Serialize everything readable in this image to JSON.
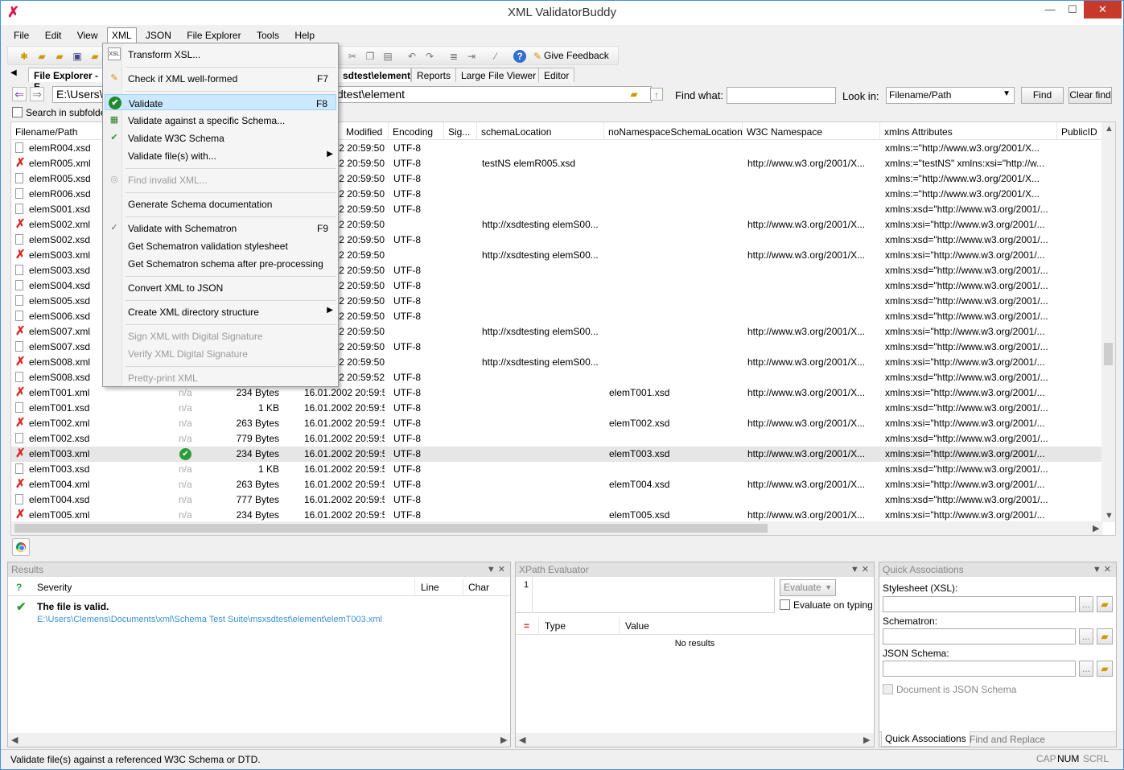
{
  "window": {
    "title": "XML ValidatorBuddy"
  },
  "menubar": [
    "File",
    "Edit",
    "View",
    "XML",
    "JSON",
    "File Explorer",
    "Tools",
    "Help"
  ],
  "toolbar": {
    "feedback_label": "Give Feedback"
  },
  "tabs": [
    "File Explorer - E",
    "sdtest\\element",
    "Reports",
    "Large File Viewer",
    "Editor"
  ],
  "path": {
    "value_left": "E:\\Users\\C",
    "value_right": "sdtest\\element"
  },
  "find": {
    "label": "Find what:",
    "lookin_label": "Look in:",
    "lookin_value": "Filename/Path",
    "find_btn": "Find",
    "clear_btn": "Clear find"
  },
  "search_subfolders": "Search in subfolders",
  "columns": [
    "Filename/Path",
    "Modified",
    "Encoding",
    "Sig...",
    "schemaLocation",
    "noNamespaceSchemaLocation",
    "W3C Namespace",
    "xmlns Attributes",
    "PublicID"
  ],
  "rows": [
    {
      "name": "elemR004.xsd",
      "icon": "doc",
      "status": "",
      "size": "",
      "mod": "02 20:59:50",
      "enc": "UTF-8",
      "schema": "",
      "nons": "",
      "w3c": "",
      "xmlns": "xmlns:=\"http://www.w3.org/2001/X..."
    },
    {
      "name": "elemR005.xml",
      "icon": "err",
      "status": "",
      "size": "",
      "mod": "02 20:59:50",
      "enc": "UTF-8",
      "schema": "testNS elemR005.xsd",
      "nons": "",
      "w3c": "http://www.w3.org/2001/X...",
      "xmlns": "xmlns:=\"testNS\" xmlns:xsi=\"http://w..."
    },
    {
      "name": "elemR005.xsd",
      "icon": "doc",
      "status": "",
      "size": "",
      "mod": "02 20:59:50",
      "enc": "UTF-8",
      "schema": "",
      "nons": "",
      "w3c": "",
      "xmlns": "xmlns:=\"http://www.w3.org/2001/X..."
    },
    {
      "name": "elemR006.xsd",
      "icon": "doc",
      "status": "",
      "size": "",
      "mod": "02 20:59:50",
      "enc": "UTF-8",
      "schema": "",
      "nons": "",
      "w3c": "",
      "xmlns": "xmlns:=\"http://www.w3.org/2001/X..."
    },
    {
      "name": "elemS001.xsd",
      "icon": "doc",
      "status": "",
      "size": "",
      "mod": "02 20:59:50",
      "enc": "UTF-8",
      "schema": "",
      "nons": "",
      "w3c": "",
      "xmlns": "xmlns:xsd=\"http://www.w3.org/2001/..."
    },
    {
      "name": "elemS002.xml",
      "icon": "err",
      "status": "",
      "size": "",
      "mod": "02 20:59:50",
      "enc": "",
      "schema": "http://xsdtesting elemS00...",
      "nons": "",
      "w3c": "http://www.w3.org/2001/X...",
      "xmlns": "xmlns:xsi=\"http://www.w3.org/2001/..."
    },
    {
      "name": "elemS002.xsd",
      "icon": "doc",
      "status": "",
      "size": "",
      "mod": "02 20:59:50",
      "enc": "UTF-8",
      "schema": "",
      "nons": "",
      "w3c": "",
      "xmlns": "xmlns:xsd=\"http://www.w3.org/2001/..."
    },
    {
      "name": "elemS003.xml",
      "icon": "err",
      "status": "",
      "size": "",
      "mod": "02 20:59:50",
      "enc": "",
      "schema": "http://xsdtesting elemS00...",
      "nons": "",
      "w3c": "http://www.w3.org/2001/X...",
      "xmlns": "xmlns:xsi=\"http://www.w3.org/2001/..."
    },
    {
      "name": "elemS003.xsd",
      "icon": "doc",
      "status": "",
      "size": "",
      "mod": "02 20:59:50",
      "enc": "UTF-8",
      "schema": "",
      "nons": "",
      "w3c": "",
      "xmlns": "xmlns:xsd=\"http://www.w3.org/2001/..."
    },
    {
      "name": "elemS004.xsd",
      "icon": "doc",
      "status": "",
      "size": "",
      "mod": "02 20:59:50",
      "enc": "UTF-8",
      "schema": "",
      "nons": "",
      "w3c": "",
      "xmlns": "xmlns:xsd=\"http://www.w3.org/2001/..."
    },
    {
      "name": "elemS005.xsd",
      "icon": "doc",
      "status": "",
      "size": "",
      "mod": "02 20:59:50",
      "enc": "UTF-8",
      "schema": "",
      "nons": "",
      "w3c": "",
      "xmlns": "xmlns:xsd=\"http://www.w3.org/2001/..."
    },
    {
      "name": "elemS006.xsd",
      "icon": "doc",
      "status": "",
      "size": "",
      "mod": "02 20:59:50",
      "enc": "UTF-8",
      "schema": "",
      "nons": "",
      "w3c": "",
      "xmlns": "xmlns:xsd=\"http://www.w3.org/2001/..."
    },
    {
      "name": "elemS007.xml",
      "icon": "err",
      "status": "",
      "size": "",
      "mod": "02 20:59:50",
      "enc": "",
      "schema": "http://xsdtesting elemS00...",
      "nons": "",
      "w3c": "http://www.w3.org/2001/X...",
      "xmlns": "xmlns:xsi=\"http://www.w3.org/2001/..."
    },
    {
      "name": "elemS007.xsd",
      "icon": "doc",
      "status": "",
      "size": "",
      "mod": "02 20:59:50",
      "enc": "UTF-8",
      "schema": "",
      "nons": "",
      "w3c": "",
      "xmlns": "xmlns:xsd=\"http://www.w3.org/2001/..."
    },
    {
      "name": "elemS008.xml",
      "icon": "err",
      "status": "",
      "size": "",
      "mod": "02 20:59:50",
      "enc": "",
      "schema": "http://xsdtesting elemS00...",
      "nons": "",
      "w3c": "http://www.w3.org/2001/X...",
      "xmlns": "xmlns:xsi=\"http://www.w3.org/2001/..."
    },
    {
      "name": "elemS008.xsd",
      "icon": "doc",
      "status": "",
      "size": "",
      "mod": "02 20:59:52",
      "enc": "UTF-8",
      "schema": "",
      "nons": "",
      "w3c": "",
      "xmlns": "xmlns:xsd=\"http://www.w3.org/2001/..."
    },
    {
      "name": "elemT001.xml",
      "icon": "err",
      "status": "n/a",
      "size": "234 Bytes",
      "mod": "16.01.2002 20:59:52",
      "enc": "UTF-8",
      "schema": "",
      "nons": "elemT001.xsd",
      "w3c": "http://www.w3.org/2001/X...",
      "xmlns": "xmlns:xsi=\"http://www.w3.org/2001/..."
    },
    {
      "name": "elemT001.xsd",
      "icon": "doc",
      "status": "n/a",
      "size": "1 KB",
      "mod": "16.01.2002 20:59:52",
      "enc": "UTF-8",
      "schema": "",
      "nons": "",
      "w3c": "",
      "xmlns": "xmlns:xsd=\"http://www.w3.org/2001/..."
    },
    {
      "name": "elemT002.xml",
      "icon": "err",
      "status": "n/a",
      "size": "263 Bytes",
      "mod": "16.01.2002 20:59:52",
      "enc": "UTF-8",
      "schema": "",
      "nons": "elemT002.xsd",
      "w3c": "http://www.w3.org/2001/X...",
      "xmlns": "xmlns:xsi=\"http://www.w3.org/2001/..."
    },
    {
      "name": "elemT002.xsd",
      "icon": "doc",
      "status": "n/a",
      "size": "779 Bytes",
      "mod": "16.01.2002 20:59:52",
      "enc": "UTF-8",
      "schema": "",
      "nons": "",
      "w3c": "",
      "xmlns": "xmlns:xsd=\"http://www.w3.org/2001/..."
    },
    {
      "name": "elemT003.xml",
      "icon": "err",
      "status": "valid",
      "size": "234 Bytes",
      "mod": "16.01.2002 20:59:52",
      "enc": "UTF-8",
      "schema": "",
      "nons": "elemT003.xsd",
      "w3c": "http://www.w3.org/2001/X...",
      "xmlns": "xmlns:xsi=\"http://www.w3.org/2001/...",
      "selected": true
    },
    {
      "name": "elemT003.xsd",
      "icon": "doc",
      "status": "n/a",
      "size": "1 KB",
      "mod": "16.01.2002 20:59:52",
      "enc": "UTF-8",
      "schema": "",
      "nons": "",
      "w3c": "",
      "xmlns": "xmlns:xsd=\"http://www.w3.org/2001/..."
    },
    {
      "name": "elemT004.xml",
      "icon": "err",
      "status": "n/a",
      "size": "263 Bytes",
      "mod": "16.01.2002 20:59:52",
      "enc": "UTF-8",
      "schema": "",
      "nons": "elemT004.xsd",
      "w3c": "http://www.w3.org/2001/X...",
      "xmlns": "xmlns:xsi=\"http://www.w3.org/2001/..."
    },
    {
      "name": "elemT004.xsd",
      "icon": "doc",
      "status": "n/a",
      "size": "777 Bytes",
      "mod": "16.01.2002 20:59:52",
      "enc": "UTF-8",
      "schema": "",
      "nons": "",
      "w3c": "",
      "xmlns": "xmlns:xsd=\"http://www.w3.org/2001/..."
    },
    {
      "name": "elemT005.xml",
      "icon": "err",
      "status": "n/a",
      "size": "234 Bytes",
      "mod": "16.01.2002 20:59:52",
      "enc": "UTF-8",
      "schema": "",
      "nons": "elemT005.xsd",
      "w3c": "http://www.w3.org/2001/X...",
      "xmlns": "xmlns:xsi=\"http://www.w3.org/2001/..."
    }
  ],
  "xml_menu": [
    {
      "label": "Transform XSL...",
      "shortcut": "",
      "icon": "xsl",
      "disabled": false
    },
    {
      "sep": true
    },
    {
      "label": "Check if XML well-formed",
      "shortcut": "F7",
      "icon": "pencil",
      "disabled": false
    },
    {
      "sep": true
    },
    {
      "label": "Validate",
      "shortcut": "F8",
      "icon": "check",
      "disabled": false,
      "highlight": true
    },
    {
      "label": "Validate against a specific Schema...",
      "shortcut": "",
      "icon": "schema",
      "disabled": false
    },
    {
      "label": "Validate W3C Schema",
      "shortcut": "",
      "icon": "w3c",
      "disabled": false
    },
    {
      "label": "Validate file(s) with...",
      "shortcut": "",
      "icon": "",
      "disabled": false,
      "submenu": true
    },
    {
      "sep": true
    },
    {
      "label": "Find invalid XML...",
      "shortcut": "",
      "icon": "search",
      "disabled": true
    },
    {
      "sep": true
    },
    {
      "label": "Generate Schema documentation",
      "shortcut": "",
      "icon": "",
      "disabled": false
    },
    {
      "sep": true
    },
    {
      "label": "Validate with Schematron",
      "shortcut": "F9",
      "icon": "schematron",
      "disabled": false
    },
    {
      "label": "Get Schematron validation stylesheet",
      "shortcut": "",
      "icon": "",
      "disabled": false
    },
    {
      "label": "Get Schematron schema after pre-processing",
      "shortcut": "",
      "icon": "",
      "disabled": false
    },
    {
      "sep": true
    },
    {
      "label": "Convert XML to JSON",
      "shortcut": "",
      "icon": "",
      "disabled": false
    },
    {
      "sep": true
    },
    {
      "label": "Create XML directory structure",
      "shortcut": "",
      "icon": "",
      "disabled": false,
      "submenu": true
    },
    {
      "sep": true
    },
    {
      "label": "Sign XML with Digital Signature",
      "shortcut": "",
      "icon": "",
      "disabled": true
    },
    {
      "label": "Verify XML Digital Signature",
      "shortcut": "",
      "icon": "",
      "disabled": true
    },
    {
      "sep": true
    },
    {
      "label": "Pretty-print XML",
      "shortcut": "",
      "icon": "",
      "disabled": true
    }
  ],
  "results": {
    "title": "Results",
    "col_mark": "?",
    "col_severity": "Severity",
    "col_line": "Line",
    "col_char": "Char",
    "message": "The file is valid.",
    "path": "E:\\Users\\Clemens\\Documents\\xml\\Schema Test Suite\\msxsdtest\\element\\elemT003.xml"
  },
  "xpath": {
    "title": "XPath Evaluator",
    "line_no": "1",
    "evaluate_btn": "Evaluate",
    "evaluate_on_typing": "Evaluate on typing",
    "col_mark": "=",
    "col_type": "Type",
    "col_value": "Value",
    "no_results": "No results"
  },
  "quick": {
    "title": "Quick Associations",
    "stylesheet_label": "Stylesheet (XSL):",
    "schematron_label": "Schematron:",
    "json_schema_label": "JSON Schema:",
    "doc_is_json_schema": "Document is JSON Schema",
    "browse": "...",
    "tab_quick": "Quick Associations",
    "tab_find": "Find and Replace"
  },
  "status": {
    "text": "Validate file(s) against a referenced W3C Schema or DTD.",
    "cap": "CAP",
    "num": "NUM",
    "scrl": "SCRL"
  },
  "colors": {
    "accent": "#1f8b2d",
    "error": "#d22222",
    "link": "#3a8fd6",
    "highlight": "#cce8ff"
  }
}
